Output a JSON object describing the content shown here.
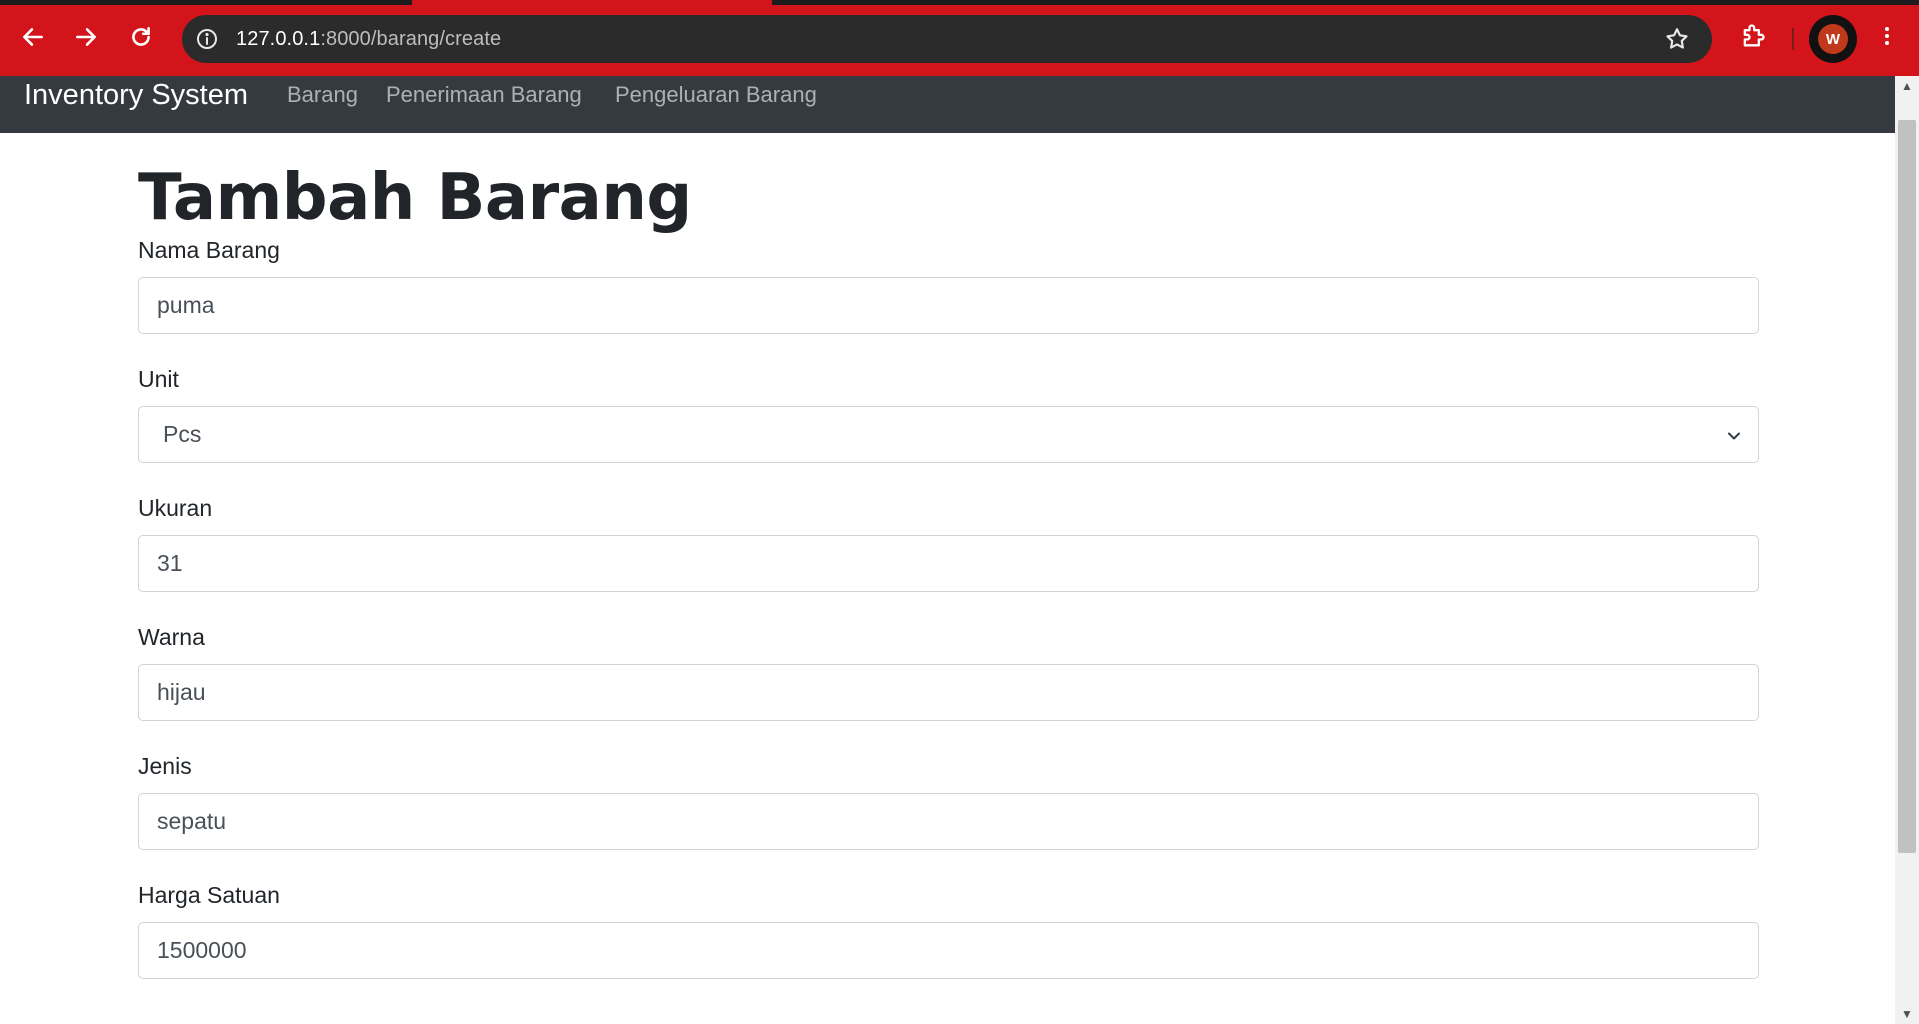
{
  "browser": {
    "url_host": "127.0.0.1",
    "url_rest": ":8000/barang/create",
    "avatar_initial": "W"
  },
  "navbar": {
    "brand": "Inventory System",
    "links": [
      {
        "label": "Barang"
      },
      {
        "label": "Penerimaan Barang"
      },
      {
        "label": "Pengeluaran Barang"
      }
    ]
  },
  "page": {
    "title": "Tambah Barang"
  },
  "form": {
    "nama_barang": {
      "label": "Nama Barang",
      "value": "puma"
    },
    "unit": {
      "label": "Unit",
      "value": "Pcs"
    },
    "ukuran": {
      "label": "Ukuran",
      "value": "31"
    },
    "warna": {
      "label": "Warna",
      "value": "hijau"
    },
    "jenis": {
      "label": "Jenis",
      "value": "sepatu"
    },
    "harga_satuan": {
      "label": "Harga Satuan",
      "value": "1500000"
    }
  },
  "icons": {
    "back": "arrow-left-icon",
    "forward": "arrow-right-icon",
    "reload": "reload-icon",
    "site_info": "info-icon",
    "bookmark": "star-icon",
    "extensions": "puzzle-icon",
    "menu": "kebab-menu-icon",
    "select": "chevron-down-icon"
  },
  "colors": {
    "chrome": "#d3141b",
    "navbar": "#343a40",
    "heading": "#212529",
    "input_border": "#ced4da"
  }
}
